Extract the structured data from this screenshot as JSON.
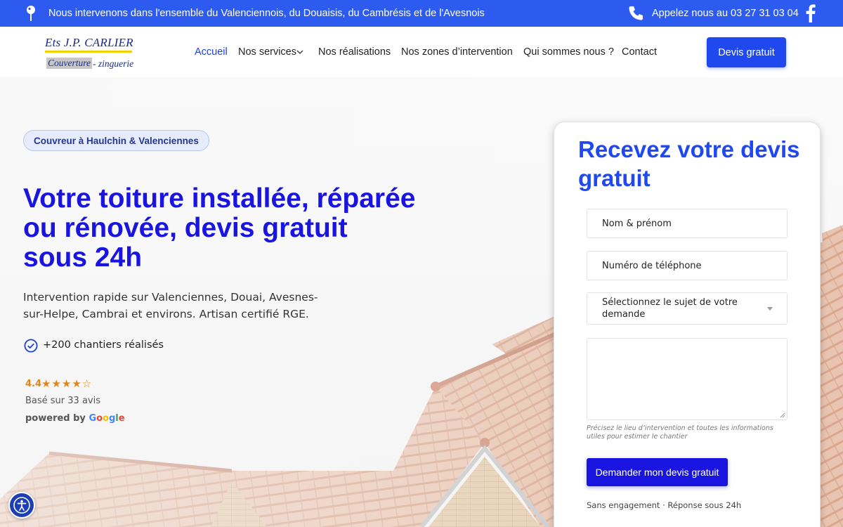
{
  "topbar": {
    "intro": "Nous intervenons dans l'ensemble du Valenciennois, du Douaisis, du Cambrésis et de l'Avesnois",
    "call": "Appelez nous au 03 27 31 03 04",
    "icons": [
      "map-pin-icon",
      "phone-icon",
      "facebook-icon"
    ],
    "bg_color": "#2d5bf0"
  },
  "logo": {
    "line1": "Ets J.P. CARLIER",
    "line2a": "Couverture",
    "line2b": "- zinguerie"
  },
  "nav": {
    "items": [
      {
        "label": "Accueil",
        "active": true
      },
      {
        "label": "Nos services",
        "has_dropdown": true
      },
      {
        "label": "Nos réalisations"
      },
      {
        "label": "Nos zones d’intervention"
      },
      {
        "label": "Qui sommes nous ?"
      },
      {
        "label": "Contact"
      }
    ],
    "cta": "Devis gratuit",
    "accent_color": "#1f49ee"
  },
  "hero": {
    "badge": "Couvreur à Haulchin & Valenciennes",
    "title": "Votre toiture installée, réparée ou rénovée, devis gratuit sous 24h",
    "subtitle": "Intervention rapide sur Valenciennes, Douai, Avesnes-sur-Helpe, Cambrai et environs. Artisan certifié RGE.",
    "chantiers": "+200 chantiers réalisés",
    "rating": {
      "score": "4.4",
      "stars": "★★★★☆",
      "based_on": "Basé sur 33 avis",
      "powered_prefix": "powered by ",
      "google": [
        "G",
        "o",
        "o",
        "g",
        "l",
        "e"
      ]
    },
    "title_color": "#1a14e0"
  },
  "form": {
    "title": "Recevez votre devis gratuit",
    "name_placeholder": "Nom & prénom",
    "phone_placeholder": "Numéro de téléphone",
    "subject_placeholder": "Sélectionnez le sujet de votre demande",
    "message_value": "",
    "hint": "Précisez le lieu d’intervention et toutes les informations utiles pour estimer le chantier",
    "submit": "Demander mon devis gratuit",
    "footer": "Sans engagement · Réponse sous 24h"
  },
  "accessibility": {
    "icon": "accessibility-icon"
  }
}
